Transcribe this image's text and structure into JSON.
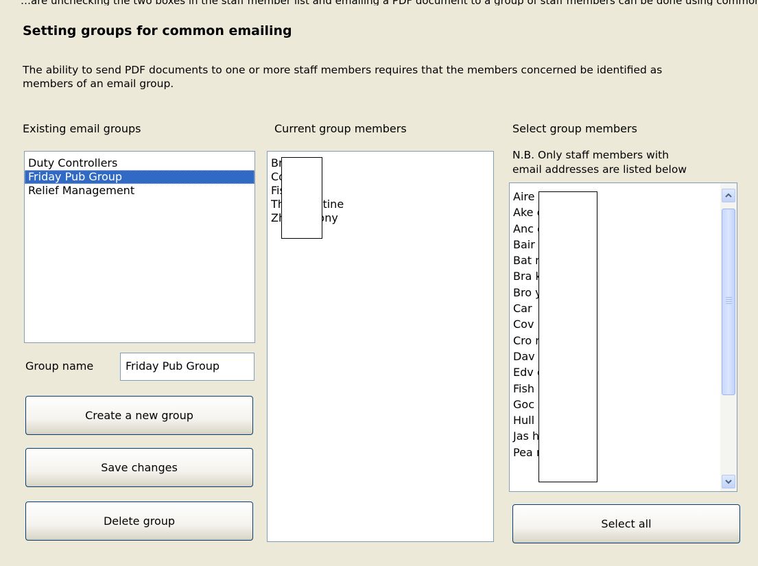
{
  "clipped_header_text": "…are unchecking the two boxes in the staff member list and emailing a PDF document to a group of staff members can be done using common email groups",
  "title": "Setting groups for common emailing",
  "description": "The ability to send PDF documents to one or more staff members requires that the members concerned be identified as members of an email group.",
  "existing_groups": {
    "label": "Existing email groups",
    "items": [
      "Duty Controllers",
      "Friday Pub Group",
      "Relief Management"
    ],
    "selected_index": 1
  },
  "group_name": {
    "label": "Group name",
    "value": "Friday Pub Group"
  },
  "buttons": {
    "create": "Create a new group",
    "save": "Save changes",
    "delete": "Delete group",
    "select_all": "Select all"
  },
  "current_members": {
    "label": "Current group members",
    "items": [
      "Brai        ark",
      "Cov        ee",
      "Fish        en",
      "Tho        Christine",
      "Zhang, Tony"
    ]
  },
  "select_members": {
    "label": "Select group members",
    "note_line1": "N.B. Only staff members with",
    "note_line2": "email addresses are listed below",
    "items": [
      "Aire        a",
      "Ake        er",
      "Anc        ebecca",
      "Bair",
      "Bat        n",
      "Bra        k",
      "Bro        y",
      "Car",
      "Cov",
      "Cro        nne",
      "Dav        th",
      "Edv        e",
      "Fish",
      "Goc        Zane",
      "Hull        et",
      "Jas        hree",
      "Pea        n"
    ]
  }
}
